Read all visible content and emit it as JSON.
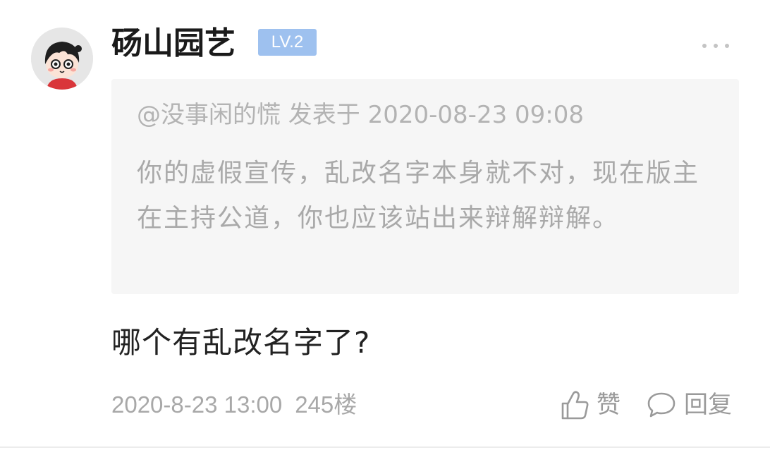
{
  "user": {
    "name": "砀山园艺",
    "level": "LV.2"
  },
  "quote": {
    "meta": "@没事闲的慌 发表于 2020-08-23 09:08",
    "text": "你的虚假宣传，乱改名字本身就不对，现在版主在主持公道，你也应该站出来辩解辩解。"
  },
  "reply": {
    "text": "哪个有乱改名字了?"
  },
  "footer": {
    "timestamp": "2020-8-23 13:00",
    "floor": "245楼",
    "like_label": "赞",
    "reply_label": "回复"
  },
  "icons": {
    "more": "more-icon",
    "like": "thumbs-up-icon",
    "reply": "comment-bubble-icon"
  },
  "colors": {
    "level_badge": "#9ec1ef",
    "quote_background": "#f6f6f6",
    "muted_text": "#a8a8a8"
  }
}
